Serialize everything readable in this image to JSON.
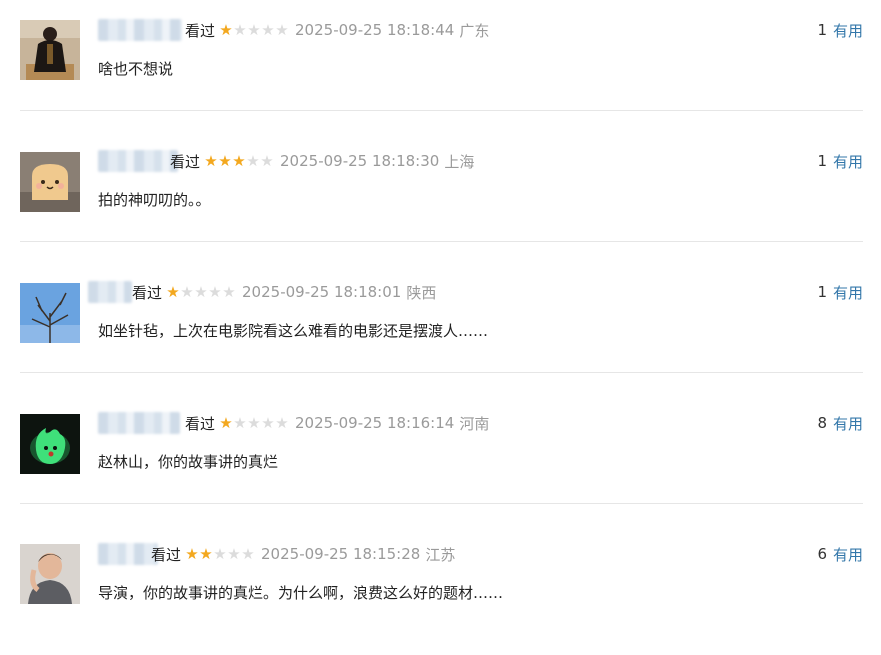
{
  "reviews": [
    {
      "status": "看过",
      "rating": 1,
      "time": "2025-09-25 18:18:44",
      "location": "广东",
      "comment": "啥也不想说",
      "votes": "1",
      "vote_label": "有用"
    },
    {
      "status": "看过",
      "rating": 3,
      "time": "2025-09-25 18:18:30",
      "location": "上海",
      "comment": "拍的神叨叨的。。",
      "votes": "1",
      "vote_label": "有用"
    },
    {
      "status": "看过",
      "rating": 1,
      "time": "2025-09-25 18:18:01",
      "location": "陕西",
      "comment": "如坐针毡，上次在电影院看这么难看的电影还是摆渡人……",
      "votes": "1",
      "vote_label": "有用"
    },
    {
      "status": "看过",
      "rating": 1,
      "time": "2025-09-25 18:16:14",
      "location": "河南",
      "comment": "赵林山，你的故事讲的真烂",
      "votes": "8",
      "vote_label": "有用"
    },
    {
      "status": "看过",
      "rating": 2,
      "time": "2025-09-25 18:15:28",
      "location": "江苏",
      "comment": "导演，你的故事讲的真烂。为什么啊，浪费这么好的题材……",
      "votes": "6",
      "vote_label": "有用"
    }
  ],
  "colors": {
    "star_on": "#f3a81f",
    "star_off": "#dcdcdc",
    "link": "#3377aa",
    "meta_gray": "#9a9a9a"
  },
  "icons": [
    "star-icon"
  ]
}
